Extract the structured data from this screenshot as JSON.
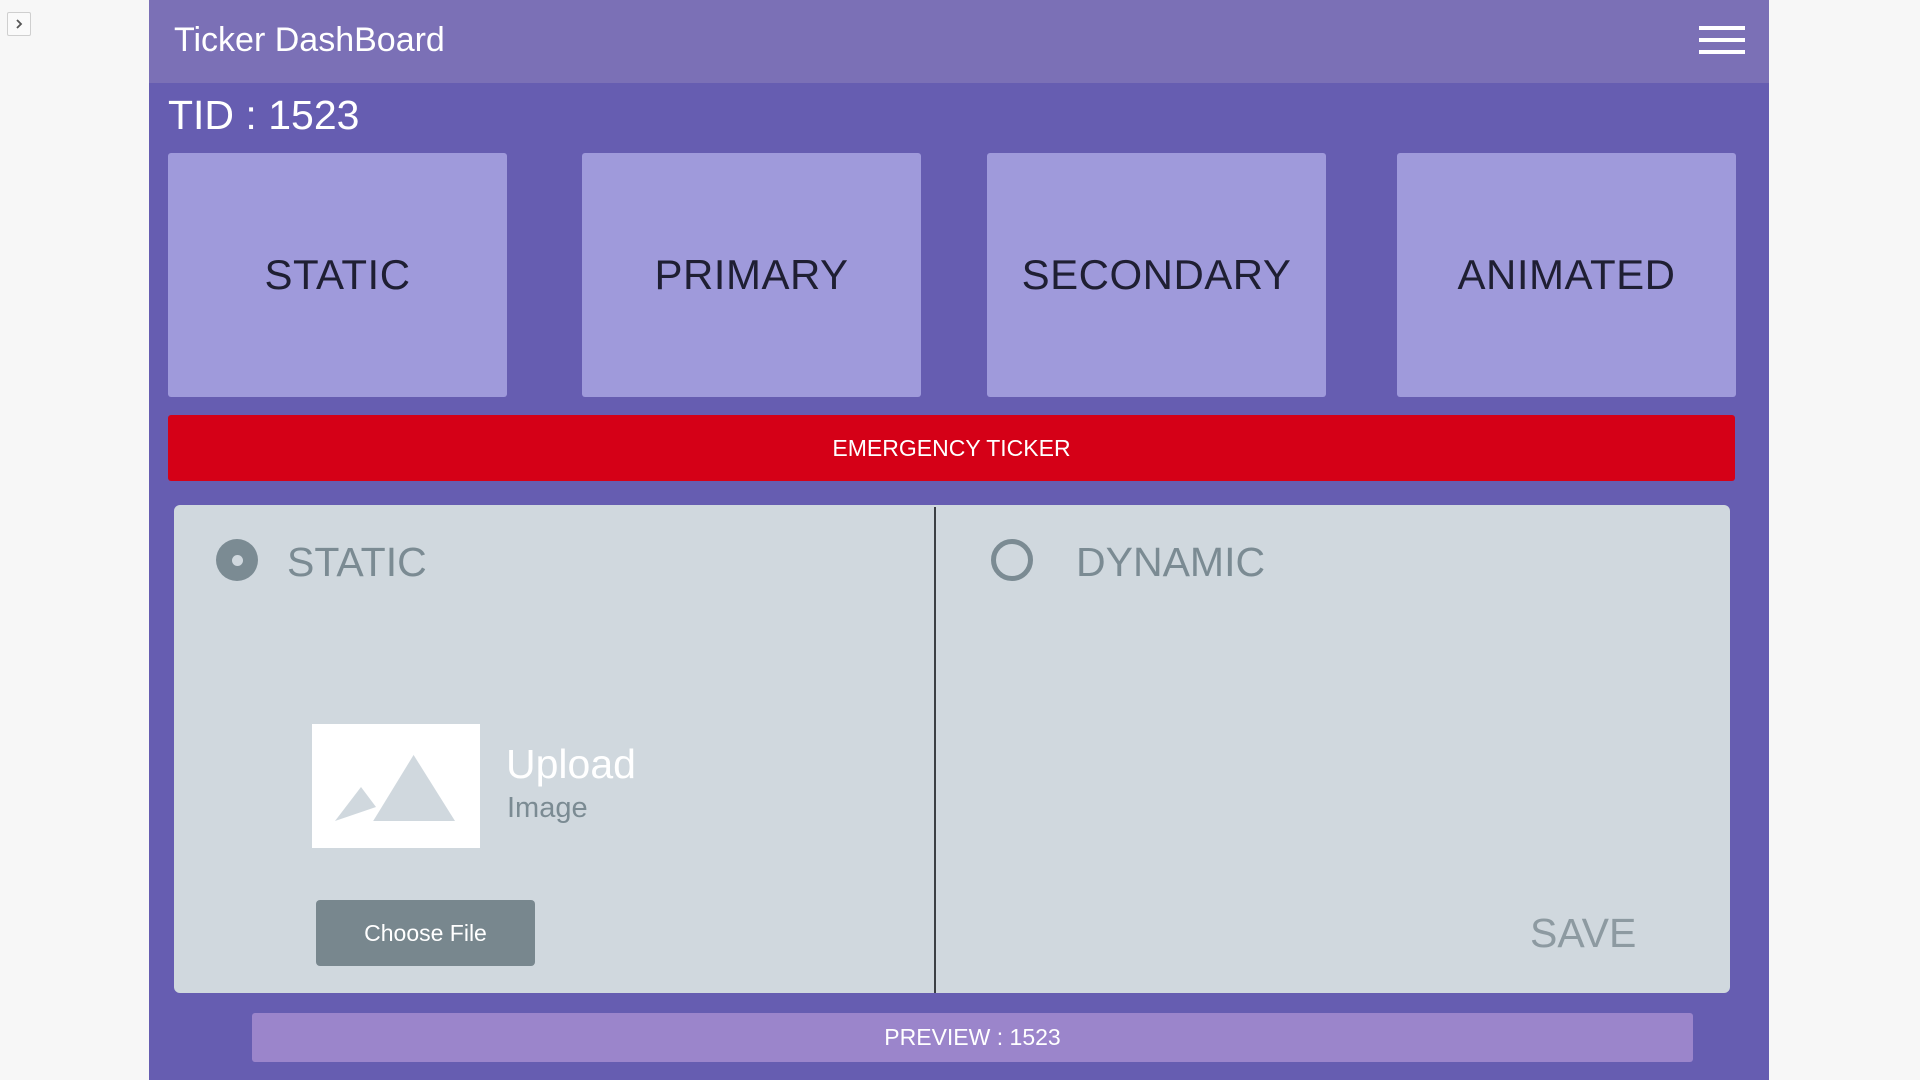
{
  "window": {
    "expand_icon": "chevron-right-icon"
  },
  "header": {
    "title": "Ticker DashBoard",
    "menu_icon": "hamburger-menu-icon"
  },
  "ticker_id_label": "TID : 1523",
  "tiles": [
    {
      "label": "STATIC"
    },
    {
      "label": "PRIMARY"
    },
    {
      "label": "SECONDARY"
    },
    {
      "label": "ANIMATED"
    }
  ],
  "emergency": {
    "label": "EMERGENCY TICKER"
  },
  "content_panel": {
    "static_option": {
      "label": "STATIC",
      "selected": true
    },
    "dynamic_option": {
      "label": "DYNAMIC",
      "selected": false
    },
    "upload": {
      "title": "Upload",
      "subtitle": "Image",
      "icon": "image-placeholder-icon"
    },
    "choose_file_label": "Choose File",
    "save_label": "SAVE"
  },
  "preview": {
    "label": "PREVIEW : 1523"
  },
  "colors": {
    "app_background": "#665db1",
    "header": "#7b70b6",
    "tile": "#9f9adb",
    "emergency": "#d50017",
    "panel": "#d0d8de",
    "button_gray": "#78878e",
    "preview_bar": "#9b85cb"
  }
}
